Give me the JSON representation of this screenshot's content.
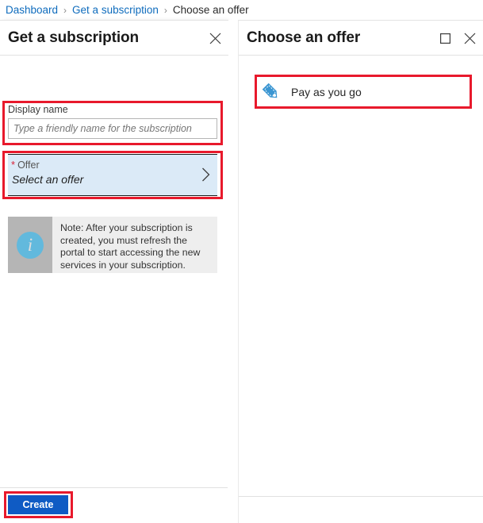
{
  "breadcrumb": {
    "items": [
      {
        "label": "Dashboard",
        "current": false
      },
      {
        "label": "Get a subscription",
        "current": false
      },
      {
        "label": "Choose an offer",
        "current": true
      }
    ],
    "separator": "›"
  },
  "left_blade": {
    "title": "Get a subscription",
    "close_icon": "close-icon",
    "display_name": {
      "label": "Display name",
      "value": "",
      "placeholder": "Type a friendly name for the subscription"
    },
    "offer": {
      "required_marker": "*",
      "label": "Offer",
      "value": "Select an offer",
      "chevron_icon": "chevron-right-icon"
    },
    "note": {
      "icon": "info-icon",
      "text": "Note: After your subscription is created, you must refresh the portal to start accessing the new services in your subscription."
    },
    "footer": {
      "create_label": "Create"
    }
  },
  "right_blade": {
    "title": "Choose an offer",
    "maximize_icon": "maximize-icon",
    "close_icon": "close-icon",
    "offers": [
      {
        "label": "Pay as you go",
        "icon": "tag-icon"
      }
    ]
  },
  "colors": {
    "highlight_outline": "#e8192c",
    "primary_button": "#0f5bc4",
    "breadcrumb_link": "#0f6cbd",
    "selected_field_background": "#dbeaf7",
    "note_background": "#eeeeee",
    "note_icon_strip": "#b5b5b5",
    "info_circle": "#62b9dd",
    "tag_icon": "#3b96d2",
    "required_star": "#d92137"
  }
}
